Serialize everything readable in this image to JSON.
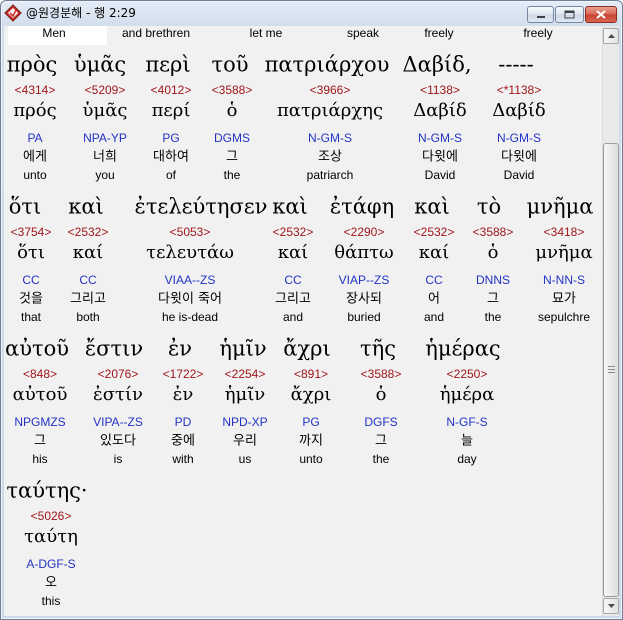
{
  "window": {
    "title": "@원경분해 - 행 2:29",
    "icons": {
      "app": "app-icon",
      "minimize": "minimize-icon",
      "maximize": "maximize-icon",
      "close": "close-icon",
      "scroll_up": "scroll-up-arrow-icon",
      "scroll_down": "scroll-down-arrow-icon"
    }
  },
  "colors": {
    "strongs_number": "#a0171b",
    "parsing_code": "#2233c4",
    "gloss_text": "#000000",
    "panel_background": "#f1f1f1",
    "selected_cell": "#ffffff",
    "close_button": "#d2473b"
  },
  "top_row": {
    "english": [
      "Men",
      "and brethren",
      "let me",
      "speak",
      "freely",
      "freely"
    ]
  },
  "rows": [
    {
      "words": [
        {
          "greek": "πρὸς",
          "strongs": "<4314>",
          "lemma": "πρός",
          "parsing": "PA",
          "korean": "에게",
          "english": "unto"
        },
        {
          "greek": "ὑμᾶς",
          "strongs": "<5209>",
          "lemma": "ὑμᾶς",
          "parsing": "NPA-YP",
          "korean": "너희",
          "english": "you"
        },
        {
          "greek": "περὶ",
          "strongs": "<4012>",
          "lemma": "περί",
          "parsing": "PG",
          "korean": "대하여",
          "english": "of"
        },
        {
          "greek": "τοῦ",
          "strongs": "<3588>",
          "lemma": "ὁ",
          "parsing": "DGMS",
          "korean": "그",
          "english": "the"
        },
        {
          "greek": "πατριάρχου",
          "strongs": "<3966>",
          "lemma": "πατριάρχης",
          "parsing": "N-GM-S",
          "korean": "조상",
          "english": "patriarch"
        },
        {
          "greek": "Δαβίδ,",
          "strongs": "<1138>",
          "lemma": "Δαβίδ",
          "parsing": "N-GM-S",
          "korean": "다윗에",
          "english": "David"
        },
        {
          "greek": "-----",
          "strongs": "<*1138>",
          "lemma": "Δαβίδ",
          "parsing": "N-GM-S",
          "korean": "다윗에",
          "english": "David"
        }
      ]
    },
    {
      "words": [
        {
          "greek": "ὅτι",
          "strongs": "<3754>",
          "lemma": "ὅτι",
          "parsing": "CC",
          "korean": "것을",
          "english": "that"
        },
        {
          "greek": "καὶ",
          "strongs": "<2532>",
          "lemma": "καί",
          "parsing": "CC",
          "korean": "그리고",
          "english": "both"
        },
        {
          "greek": "ἐτελεύτησεν",
          "strongs": "<5053>",
          "lemma": "τελευτάω",
          "parsing": "VIAA--ZS",
          "korean": "다윗이 죽어",
          "english": "he is-dead"
        },
        {
          "greek": "καὶ",
          "strongs": "<2532>",
          "lemma": "καί",
          "parsing": "CC",
          "korean": "그리고",
          "english": "and"
        },
        {
          "greek": "ἐτάφη",
          "strongs": "<2290>",
          "lemma": "θάπτω",
          "parsing": "VIAP--ZS",
          "korean": "장사되",
          "english": "buried"
        },
        {
          "greek": "καὶ",
          "strongs": "<2532>",
          "lemma": "καί",
          "parsing": "CC",
          "korean": "어",
          "english": "and"
        },
        {
          "greek": "τὸ",
          "strongs": "<3588>",
          "lemma": "ὁ",
          "parsing": "DNNS",
          "korean": "그",
          "english": "the"
        },
        {
          "greek": "μνῆμα",
          "strongs": "<3418>",
          "lemma": "μνῆμα",
          "parsing": "N-NN-S",
          "korean": "묘가",
          "english": "sepulchre"
        }
      ]
    },
    {
      "words": [
        {
          "greek": "αὐτοῦ",
          "strongs": "<848>",
          "lemma": "αὐτοῦ",
          "parsing": "NPGMZS",
          "korean": "그",
          "english": "his"
        },
        {
          "greek": "ἔστιν",
          "strongs": "<2076>",
          "lemma": "ἐστίν",
          "parsing": "VIPA--ZS",
          "korean": "있도다",
          "english": "is"
        },
        {
          "greek": "ἐν",
          "strongs": "<1722>",
          "lemma": "ἐν",
          "parsing": "PD",
          "korean": "중에",
          "english": "with"
        },
        {
          "greek": "ἡμῖν",
          "strongs": "<2254>",
          "lemma": "ἡμῖν",
          "parsing": "NPD-XP",
          "korean": "우리",
          "english": "us"
        },
        {
          "greek": "ἄχρι",
          "strongs": "<891>",
          "lemma": "ἄχρι",
          "parsing": "PG",
          "korean": "까지",
          "english": "unto"
        },
        {
          "greek": "τῆς",
          "strongs": "<3588>",
          "lemma": "ὁ",
          "parsing": "DGFS",
          "korean": "그",
          "english": "the"
        },
        {
          "greek": "ἡμέρας",
          "strongs": "<2250>",
          "lemma": "ἡμέρα",
          "parsing": "N-GF-S",
          "korean": "늘",
          "english": "day"
        }
      ]
    },
    {
      "words": [
        {
          "greek": "ταύτης·",
          "strongs": "<5026>",
          "lemma": "ταύτη",
          "parsing": "A-DGF-S",
          "korean": "오",
          "english": "this"
        }
      ]
    }
  ]
}
